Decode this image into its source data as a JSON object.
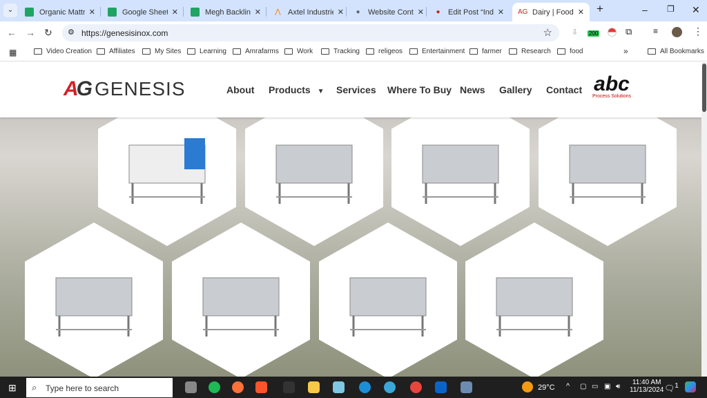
{
  "browser": {
    "tabs": [
      {
        "title": "Organic Mattres",
        "icon": "sheets-icon",
        "color": "#1fa463"
      },
      {
        "title": "Google Sheets",
        "icon": "sheets-icon",
        "color": "#1fa463"
      },
      {
        "title": "Megh Backlinks",
        "icon": "sheets-icon",
        "color": "#1fa463"
      },
      {
        "title": "Axtel Industries",
        "icon": "axtel-icon",
        "color": "#f57c00"
      },
      {
        "title": "Website Content",
        "icon": "chatgpt-icon",
        "color": "#666666"
      },
      {
        "title": "Edit Post “Indust",
        "icon": "gear-red-icon",
        "color": "#c62828"
      },
      {
        "title": "Dairy | Food | Ph",
        "icon": "genesis-icon",
        "color": "#d32027"
      }
    ],
    "url": "https://genesisinox.com",
    "extension_badge": "200",
    "bookmarks": [
      "Video Creation",
      "Affiliates",
      "My Sites",
      "Learning",
      "Amrafarms",
      "Work",
      "Tracking",
      "religeos",
      "Entertainment",
      "farmer",
      "Research",
      "food"
    ],
    "all_bookmarks": "All Bookmarks"
  },
  "site": {
    "logo_text": "GENESIS",
    "nav": [
      "About",
      "Products",
      "Services",
      "Where To Buy",
      "News",
      "Gallery",
      "Contact"
    ],
    "partner_logo": {
      "name": "abc",
      "tagline": "Process Solutions"
    }
  },
  "taskbar": {
    "search_placeholder": "Type here to search",
    "weather": "29°C",
    "time": "11:40 AM",
    "date": "11/13/2024",
    "notifications": "1"
  }
}
